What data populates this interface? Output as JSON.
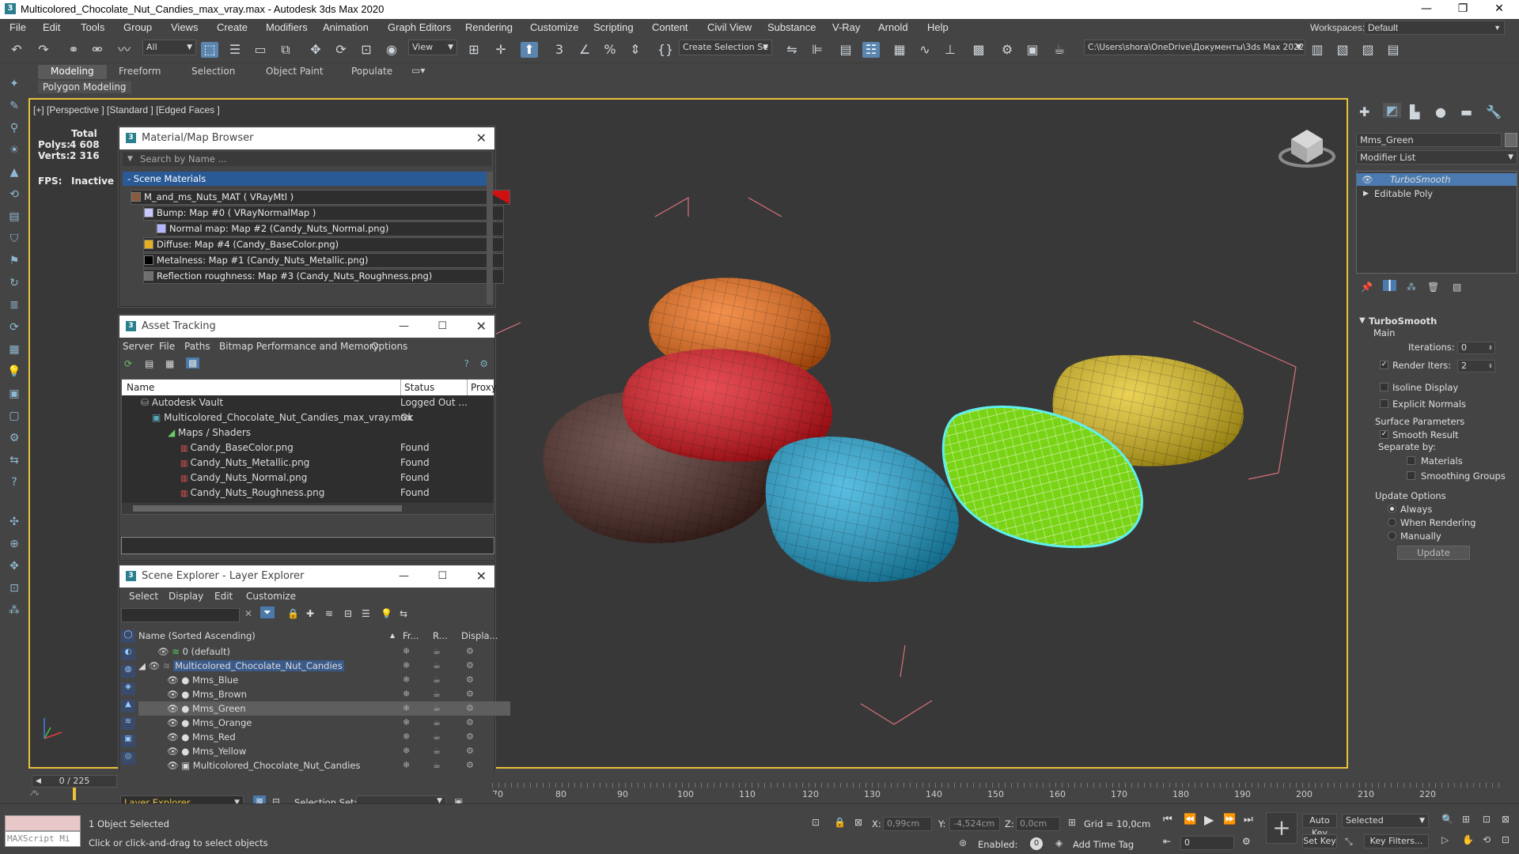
{
  "titlebar": {
    "title": "Multicolored_Chocolate_Nut_Candies_max_vray.max - Autodesk 3ds Max 2020",
    "minimize": "—",
    "maximize": "❐",
    "close": "✕"
  },
  "menu": [
    "File",
    "Edit",
    "Tools",
    "Group",
    "Views",
    "Create",
    "Modifiers",
    "Animation",
    "Graph Editors",
    "Rendering",
    "Customize",
    "Scripting",
    "Content",
    "Civil View",
    "Substance",
    "V-Ray",
    "Arnold",
    "Help"
  ],
  "workspace": {
    "label": "Workspaces:",
    "value": "Default"
  },
  "toolbar": {
    "selection_filter": "All",
    "view_dropdown": "View",
    "create_selection": "Create Selection Se",
    "path": "C:\\Users\\shora\\OneDrive\\Документы\\3ds Max 2022"
  },
  "ribbon": {
    "tabs": [
      "Modeling",
      "Freeform",
      "Selection",
      "Object Paint",
      "Populate"
    ],
    "active_tab": "Modeling",
    "subtab": "Polygon Modeling"
  },
  "viewport": {
    "label": "[+] [Perspective ] [Standard ] [Edged Faces ]",
    "stats": {
      "total_label": "Total",
      "polys_label": "Polys:",
      "polys": "4 608",
      "verts_label": "Verts:",
      "verts": "2 316",
      "fps_label": "FPS:",
      "fps": "Inactive"
    }
  },
  "material_browser": {
    "title": "Material/Map Browser",
    "search_placeholder": "Search by Name ...",
    "section": "- Scene Materials",
    "rows": [
      {
        "text": "M_and_ms_Nuts_MAT  ( VRayMtl )",
        "swatch": "#8a5a3a"
      },
      {
        "text": "Bump: Map #0  ( VRayNormalMap )",
        "swatch": "#c8c8ff"
      },
      {
        "text": "Normal map: Map #2 (Candy_Nuts_Normal.png)",
        "swatch": "#b4b4ff"
      },
      {
        "text": "Diffuse: Map #4 (Candy_BaseColor.png)",
        "swatch": "#e8b020"
      },
      {
        "text": "Metalness: Map #1 (Candy_Nuts_Metallic.png)",
        "swatch": "#000000"
      },
      {
        "text": "Reflection roughness: Map #3 (Candy_Nuts_Roughness.png)",
        "swatch": "#707070"
      }
    ]
  },
  "asset_tracking": {
    "title": "Asset Tracking",
    "menu": [
      "Server",
      "File",
      "Paths",
      "Bitmap Performance and Memory",
      "Options"
    ],
    "columns": [
      "Name",
      "Status",
      "Proxy"
    ],
    "rows": [
      {
        "name": "Autodesk Vault",
        "status": "Logged Out ...",
        "indent": 1
      },
      {
        "name": "Multicolored_Chocolate_Nut_Candies_max_vray.max",
        "status": "Ok",
        "indent": 2
      },
      {
        "name": "Maps / Shaders",
        "status": "",
        "indent": 3
      },
      {
        "name": "Candy_BaseColor.png",
        "status": "Found",
        "indent": 4
      },
      {
        "name": "Candy_Nuts_Metallic.png",
        "status": "Found",
        "indent": 4
      },
      {
        "name": "Candy_Nuts_Normal.png",
        "status": "Found",
        "indent": 4
      },
      {
        "name": "Candy_Nuts_Roughness.png",
        "status": "Found",
        "indent": 4
      }
    ]
  },
  "scene_explorer": {
    "title": "Scene Explorer - Layer Explorer",
    "menu": [
      "Select",
      "Display",
      "Edit",
      "Customize"
    ],
    "columns": [
      "Name (Sorted Ascending)",
      "Fr...",
      "R...",
      "Displa..."
    ],
    "rows": [
      {
        "name": "0 (default)",
        "indent": 1,
        "selected": false
      },
      {
        "name": "Multicolored_Chocolate_Nut_Candies",
        "indent": 1,
        "selected": false
      },
      {
        "name": "Mms_Blue",
        "indent": 2,
        "selected": false
      },
      {
        "name": "Mms_Brown",
        "indent": 2,
        "selected": false
      },
      {
        "name": "Mms_Green",
        "indent": 2,
        "selected": true
      },
      {
        "name": "Mms_Orange",
        "indent": 2,
        "selected": false
      },
      {
        "name": "Mms_Red",
        "indent": 2,
        "selected": false
      },
      {
        "name": "Mms_Yellow",
        "indent": 2,
        "selected": false
      },
      {
        "name": "Multicolored_Chocolate_Nut_Candies",
        "indent": 2,
        "selected": false
      }
    ],
    "footer_dropdown": "Layer Explorer",
    "selection_set_label": "Selection Set:"
  },
  "command_panel": {
    "object_name": "Mms_Green",
    "modifier_list": "Modifier List",
    "stack": [
      "TurboSmooth",
      "Editable Poly"
    ],
    "rollout_title": "TurboSmooth",
    "main_label": "Main",
    "iterations_label": "Iterations:",
    "iterations": "0",
    "render_iters_label": "Render Iters:",
    "render_iters": "2",
    "isoline_display": "Isoline Display",
    "explicit_normals": "Explicit Normals",
    "surface_params": "Surface Parameters",
    "smooth_result": "Smooth Result",
    "separate_by": "Separate by:",
    "materials": "Materials",
    "smoothing_groups": "Smoothing Groups",
    "update_options": "Update Options",
    "always": "Always",
    "when_rendering": "When Rendering",
    "manually": "Manually",
    "update_button": "Update"
  },
  "timeline": {
    "frame": "0 / 225",
    "ticks": [
      "70",
      "80",
      "90",
      "100",
      "110",
      "120",
      "130",
      "140",
      "150",
      "160",
      "170",
      "180",
      "190",
      "200",
      "210",
      "220"
    ]
  },
  "statusbar": {
    "objects_selected": "1 Object Selected",
    "prompt": "Click or click-and-drag to select objects",
    "maxscript": "MAXScript Mi",
    "x_label": "X:",
    "x": "0,99cm",
    "y_label": "Y:",
    "y": "-4,524cm",
    "z_label": "Z:",
    "z": "0,0cm",
    "grid": "Grid = 10,0cm",
    "enabled_label": "Enabled:",
    "add_time_tag": "Add Time Tag",
    "auto_key": "Auto Key",
    "set_key": "Set Key",
    "key_mode": "Selected",
    "key_filters": "Key Filters...",
    "current_frame": "0"
  }
}
